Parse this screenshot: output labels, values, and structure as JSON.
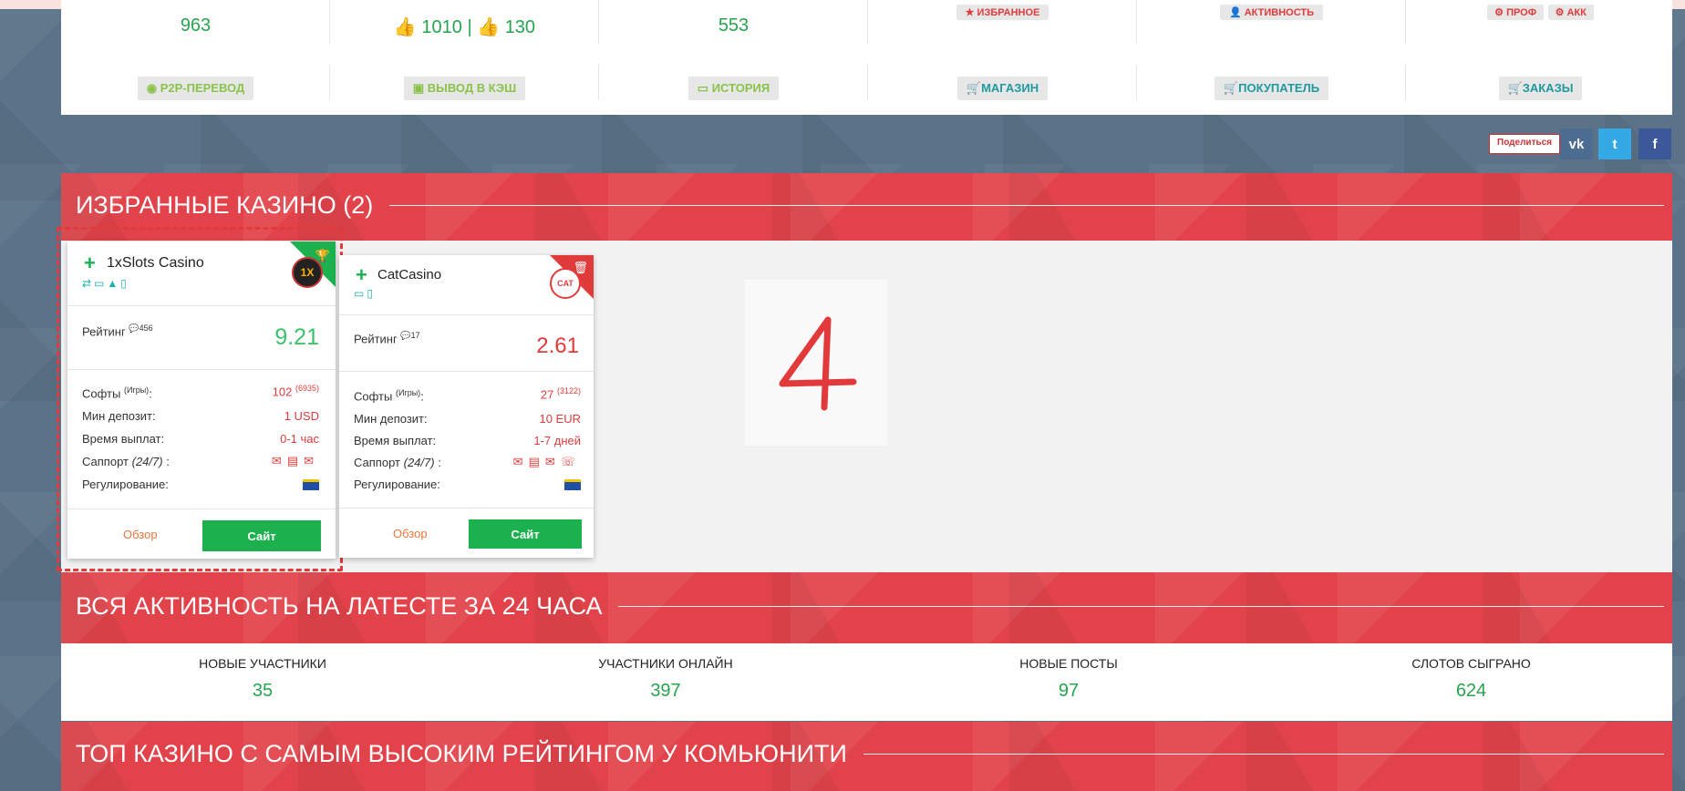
{
  "top_stats": {
    "balance": "963",
    "votes_up": "1010",
    "votes_sep": "|",
    "votes_down": "130",
    "third": "553"
  },
  "top_links": {
    "favorites": "ИЗБРАННОЕ",
    "activity": "АКТИВНОСТЬ",
    "profile": "ПРОФ",
    "account": "АКК"
  },
  "action_chips": [
    {
      "label": "P2P-ПЕРЕВОД",
      "icon": "user-circle-icon"
    },
    {
      "label": "ВЫВОД В КЭШ",
      "icon": "money-icon"
    },
    {
      "label": "ИСТОРИЯ",
      "icon": "card-icon"
    },
    {
      "label": "МАГАЗИН",
      "icon": "cart-icon"
    },
    {
      "label": "ПОКУПАТЕЛЬ",
      "icon": "cart-icon"
    },
    {
      "label": "ЗАКАЗЫ",
      "icon": "cart-icon"
    }
  ],
  "share": {
    "label": "Поделиться",
    "vk": "vk",
    "twitter": "t",
    "facebook": "f",
    "colors": {
      "vk": "#4c6c91",
      "twitter": "#35a9e6",
      "facebook": "#3b5998"
    }
  },
  "favorites_section": {
    "title": "ИЗБРАННЫЕ КАЗИНО (2)",
    "cards": [
      {
        "name": "1xSlots Casino",
        "logo_text": "1X",
        "rating_label": "Рейтинг",
        "rating_count": "456",
        "rating": "9.21",
        "rating_color": "#3cc26a",
        "softs_label": "Софты",
        "softs_sup": "(Игры)",
        "softs_value": "102",
        "softs_games": "(6935)",
        "min_dep_label": "Мин депозит:",
        "min_dep": "1 USD",
        "payout_label": "Время выплат:",
        "payout": "0-1 час",
        "support_label": "Саппорт",
        "support_hours": "(24/7)",
        "regulation_label": "Регулирование:",
        "review": "Обзор",
        "site": "Сайт"
      },
      {
        "name": "CatCasino",
        "logo_text": "CAT",
        "rating_label": "Рейтинг",
        "rating_count": "17",
        "rating": "2.61",
        "rating_color": "#e03b3b",
        "softs_label": "Софты",
        "softs_sup": "(Игры)",
        "softs_value": "27",
        "softs_games": "(3122)",
        "min_dep_label": "Мин депозит:",
        "min_dep": "10 EUR",
        "payout_label": "Время выплат:",
        "payout": "1-7 дней",
        "support_label": "Саппорт",
        "support_hours": "(24/7)",
        "regulation_label": "Регулирование:",
        "review": "Обзор",
        "site": "Сайт"
      }
    ],
    "annotation": "4"
  },
  "activity_section": {
    "title": "ВСЯ АКТИВНОСТЬ НА ЛАТЕСТЕ ЗА 24 ЧАСА",
    "stats": [
      {
        "label": "НОВЫЕ УЧАСТНИКИ",
        "value": "35"
      },
      {
        "label": "УЧАСТНИКИ ОНЛАЙН",
        "value": "397"
      },
      {
        "label": "НОВЫЕ ПОСТЫ",
        "value": "97"
      },
      {
        "label": "СЛОТОВ СЫГРАНО",
        "value": "624"
      }
    ]
  },
  "top_section": {
    "title": "ТОП КАЗИНО С САМЫМ ВЫСОКИМ РЕЙТИНГОМ У КОМЬЮНИТИ"
  }
}
